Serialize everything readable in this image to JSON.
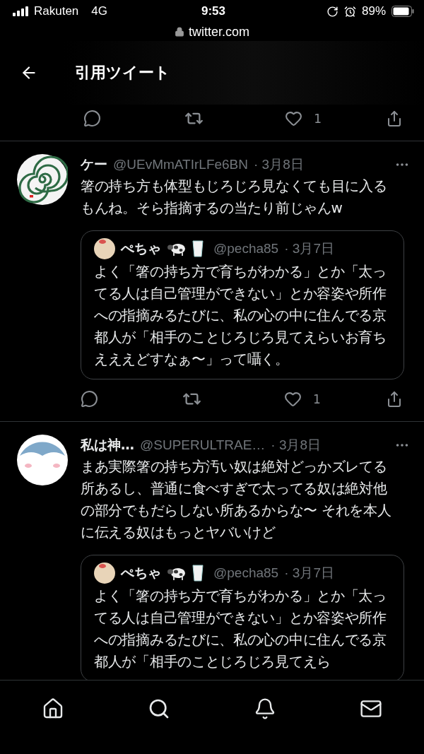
{
  "status_bar": {
    "carrier": "Rakuten",
    "network": "4G",
    "time": "9:53",
    "battery": "89%"
  },
  "url_bar": {
    "domain": "twitter.com"
  },
  "header": {
    "title": "引用ツイート"
  },
  "top_actions": {
    "like_count": "1"
  },
  "tweets": [
    {
      "avatar": {
        "kind": "spiral"
      },
      "name": "ケー",
      "handle": "@UEvMmATIrLFe6BN",
      "date": "· 3月8日",
      "text": "箸の持ち方も体型もじろじろ見なくても目に入るもんね。そら指摘するの当たり前じゃんw",
      "quote": {
        "avatar": {
          "kind": "mascot"
        },
        "name": "ぺちゃ",
        "handle": "@pecha85",
        "date": "· 3月7日",
        "text": "よく「箸の持ち方で育ちがわかる」とか「太ってる人は自己管理ができない」とか容姿や所作への指摘みるたびに、私の心の中に住んでる京都人が「相手のことじろじろ見てえらいお育ちえええどすなぁ〜」って囁く。"
      },
      "actions": {
        "like_count": "1"
      }
    },
    {
      "avatar": {
        "kind": "character"
      },
      "name": "私は神…",
      "handle": "@SUPERULTRAE…",
      "date": "· 3月8日",
      "text": "まあ実際箸の持ち方汚い奴は絶対どっかズレてる所あるし、普通に食べすぎで太ってる奴は絶対他の部分でもだらしない所あるからな〜 それを本人に伝える奴はもっとヤバいけど",
      "quote": {
        "avatar": {
          "kind": "mascot"
        },
        "name": "ぺちゃ",
        "handle": "@pecha85",
        "date": "· 3月7日",
        "text": "よく「箸の持ち方で育ちがわかる」とか「太ってる人は自己管理ができない」とか容姿や所作への指摘みるたびに、私の心の中に住んでる京都人が「相手のことじろじろ見てえら"
      }
    }
  ],
  "bottom_nav": [
    {
      "kind": "home"
    },
    {
      "kind": "search"
    },
    {
      "kind": "notifications"
    },
    {
      "kind": "messages"
    }
  ]
}
